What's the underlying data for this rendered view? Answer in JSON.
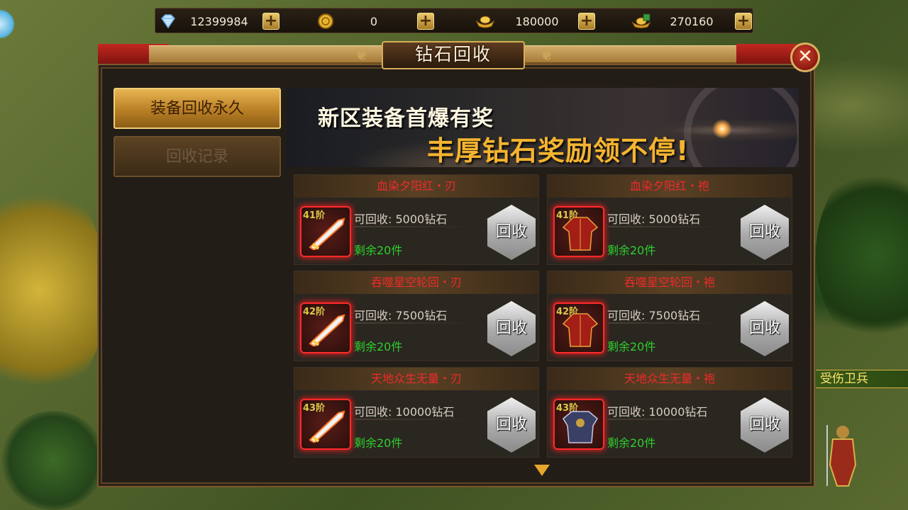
{
  "currency": [
    {
      "icon": "diamond-icon",
      "value": "12399984"
    },
    {
      "icon": "gold-coin-icon",
      "value": "0"
    },
    {
      "icon": "gold-ingot-icon",
      "value": "180000"
    },
    {
      "icon": "bound-ingot-icon",
      "value": "270160"
    }
  ],
  "panel": {
    "title": "钻石回收"
  },
  "side": {
    "tab_active": "装备回收永久",
    "tab_inactive": "回收记录"
  },
  "banner": {
    "line1": "新区装备首爆有奖",
    "line2": "丰厚钻石奖励领不停!"
  },
  "items": [
    {
      "name": "血染夕阳红・刃",
      "tier": "41阶",
      "price": "可回收: 5000钻石",
      "stock": "剩余20件",
      "button": "回收",
      "icon": "blade-icon"
    },
    {
      "name": "血染夕阳红・袍",
      "tier": "41阶",
      "price": "可回收: 5000钻石",
      "stock": "剩余20件",
      "button": "回收",
      "icon": "robe-icon"
    },
    {
      "name": "吞噬星空轮回・刃",
      "tier": "42阶",
      "price": "可回收: 7500钻石",
      "stock": "剩余20件",
      "button": "回收",
      "icon": "blade-icon"
    },
    {
      "name": "吞噬星空轮回・袍",
      "tier": "42阶",
      "price": "可回收: 7500钻石",
      "stock": "剩余20件",
      "button": "回收",
      "icon": "robe-icon"
    },
    {
      "name": "天地众生无量・刃",
      "tier": "43阶",
      "price": "可回收: 10000钻石",
      "stock": "剩余20件",
      "button": "回收",
      "icon": "blade-icon"
    },
    {
      "name": "天地众生无量・袍",
      "tier": "43阶",
      "price": "可回收: 10000钻石",
      "stock": "剩余20件",
      "button": "回收",
      "icon": "armor-icon"
    }
  ],
  "npc": {
    "name": "受伤卫兵"
  },
  "colors": {
    "item_name": "#ee2b2b",
    "stock": "#2ed02e",
    "tier": "#d8c84a",
    "npc_name": "#ffe66a"
  }
}
